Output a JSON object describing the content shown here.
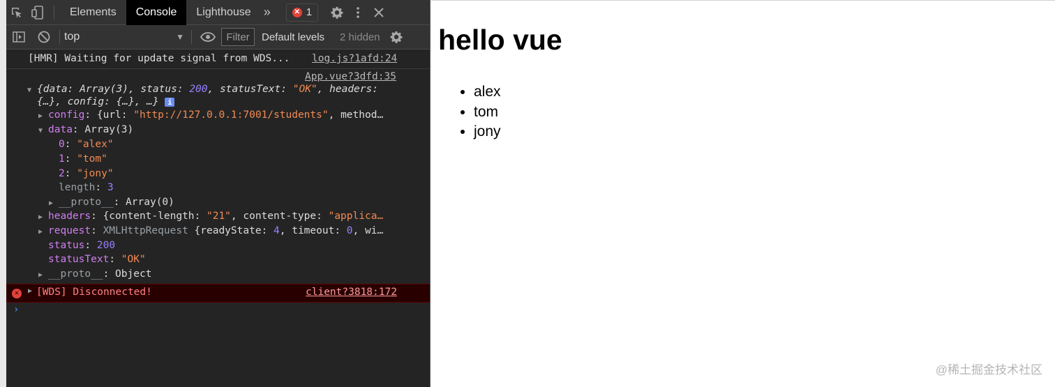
{
  "devtools": {
    "tabs": [
      {
        "label": "Elements"
      },
      {
        "label": "Console"
      },
      {
        "label": "Lighthouse"
      }
    ],
    "more_tabs_icon": "double-chevron-icon",
    "error_count": "1",
    "toolbar": {
      "context": "top",
      "filter_placeholder": "Filter",
      "levels": "Default levels",
      "hidden": "2 hidden"
    }
  },
  "console": {
    "hmr_message": "[HMR] Waiting for update signal from WDS...",
    "hmr_source": "log.js?1afd:24",
    "log_source": "App.vue?3dfd:35",
    "response_summary": {
      "p1": "{",
      "k_data": "data",
      "v_data": "Array(3)",
      "k_status": "status",
      "v_status": "200",
      "k_statusText": "statusText",
      "v_statusText": "\"OK\"",
      "k_headers": "headers",
      "line2_a": "{…}",
      "k_config": "config",
      "line2_b": "{…}, …}"
    },
    "config_line": {
      "key": "config",
      "open": "{url: ",
      "url": "\"http://127.0.0.1:7001/students\"",
      "rest": ", method…"
    },
    "data_line": {
      "key": "data",
      "value": "Array(3)"
    },
    "data_items": [
      {
        "index": "0",
        "value": "\"alex\""
      },
      {
        "index": "1",
        "value": "\"tom\""
      },
      {
        "index": "2",
        "value": "\"jony\""
      }
    ],
    "length_line": {
      "key": "length",
      "value": "3"
    },
    "proto_array": {
      "key": "__proto__",
      "value": "Array(0)"
    },
    "headers_line": {
      "key": "headers",
      "open": "{content-length: ",
      "cl": "\"21\"",
      "mid": ", content-type: ",
      "ct": "\"applica…"
    },
    "request_line": {
      "key": "request",
      "type": "XMLHttpRequest",
      "open": "{readyState: ",
      "rs": "4",
      "mid": ", timeout: ",
      "to": "0",
      "rest": ", wi…"
    },
    "status_line": {
      "key": "status",
      "value": "200"
    },
    "statusText_line": {
      "key": "statusText",
      "value": "\"OK\""
    },
    "proto_object": {
      "key": "__proto__",
      "value": "Object"
    },
    "error_message": "[WDS] Disconnected!",
    "error_source": "client?3818:172"
  },
  "page": {
    "title": "hello vue",
    "students": [
      "alex",
      "tom",
      "jony"
    ]
  },
  "watermark": "@稀土掘金技术社区"
}
